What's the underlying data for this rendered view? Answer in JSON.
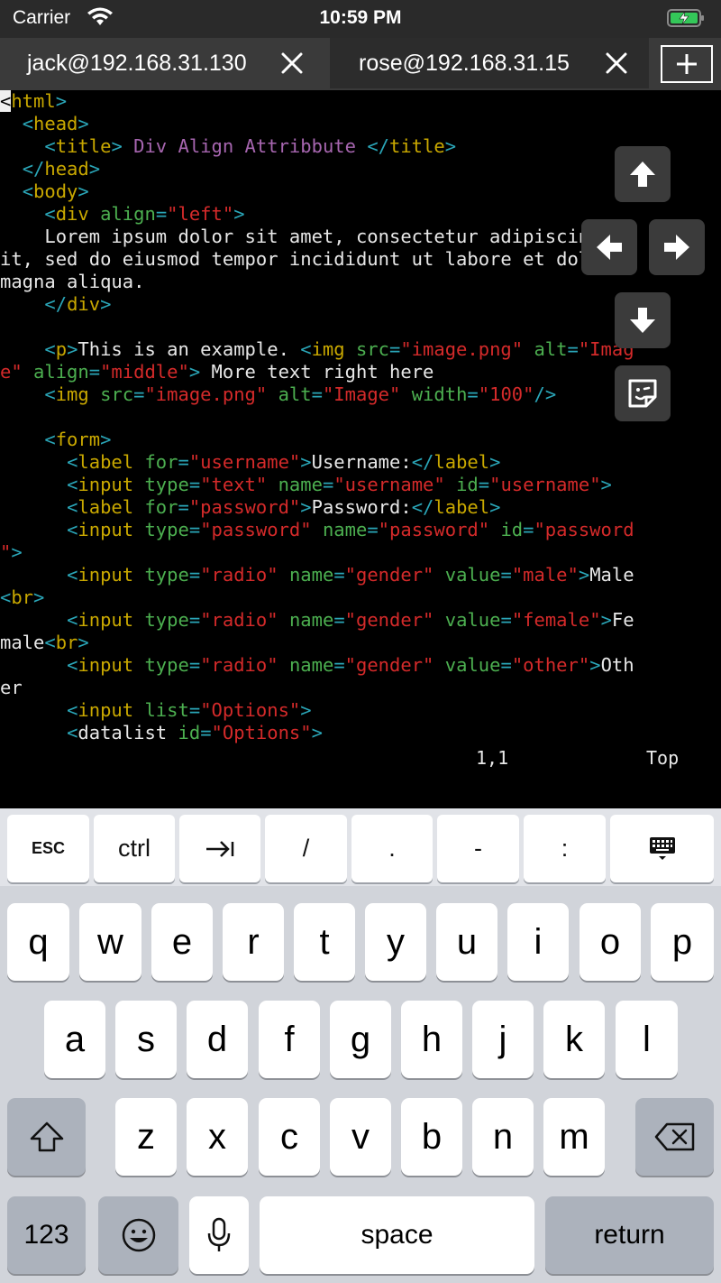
{
  "status_bar": {
    "carrier": "Carrier",
    "time": "10:59 PM"
  },
  "tabs": [
    {
      "label": "jack@192.168.31.130",
      "active": true
    },
    {
      "label": "rose@192.168.31.15",
      "active": false
    }
  ],
  "editor": {
    "cursor_char": "<",
    "lines": {
      "l1": "html",
      "l3_title": "title",
      "l3_text": " Div Align Attribbute ",
      "l4": "head",
      "l5": "body",
      "l2": "head"
    },
    "status_position": "1,1",
    "status_scroll": "Top"
  },
  "keyboard": {
    "toolbar": [
      "ESC",
      "ctrl",
      "tab",
      "/",
      ".",
      "-",
      ":",
      "keyboard-hide"
    ],
    "row1": [
      "q",
      "w",
      "e",
      "r",
      "t",
      "y",
      "u",
      "i",
      "o",
      "p"
    ],
    "row2": [
      "a",
      "s",
      "d",
      "f",
      "g",
      "h",
      "j",
      "k",
      "l"
    ],
    "row3": [
      "z",
      "x",
      "c",
      "v",
      "b",
      "n",
      "m"
    ],
    "numbers_label": "123",
    "space_label": "space",
    "return_label": "return",
    "esc_label": "ESC",
    "ctrl_label": "ctrl",
    "slash_label": "/",
    "dot_label": ".",
    "dash_label": "-",
    "colon_label": ":"
  }
}
